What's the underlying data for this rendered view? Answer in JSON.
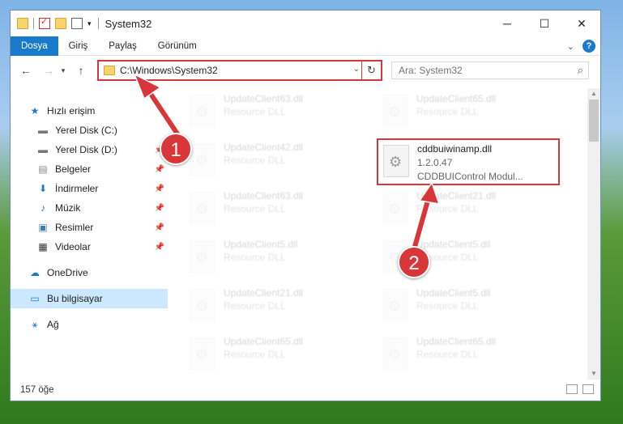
{
  "window": {
    "title": "System32",
    "minimize": "─",
    "maximize": "☐",
    "close": "✕"
  },
  "ribbon": {
    "tabs": [
      "Dosya",
      "Giriş",
      "Paylaş",
      "Görünüm"
    ],
    "expand_icon": "chevron-down-icon",
    "help": "?"
  },
  "address": {
    "path": "C:\\Windows\\System32",
    "search_placeholder": "Ara: System32"
  },
  "sidebar": {
    "items": [
      {
        "label": "Hızlı erişim",
        "icon": "star-icon"
      },
      {
        "label": "Yerel Disk (C:)",
        "icon": "drive-icon"
      },
      {
        "label": "Yerel Disk (D:)",
        "icon": "drive-icon"
      },
      {
        "label": "Belgeler",
        "icon": "documents-icon"
      },
      {
        "label": "İndirmeler",
        "icon": "download-icon"
      },
      {
        "label": "Müzik",
        "icon": "music-icon"
      },
      {
        "label": "Resimler",
        "icon": "pictures-icon"
      },
      {
        "label": "Videolar",
        "icon": "video-icon"
      },
      {
        "label": "OneDrive",
        "icon": "cloud-icon"
      },
      {
        "label": "Bu bilgisayar",
        "icon": "computer-icon"
      },
      {
        "label": "Ağ",
        "icon": "network-icon"
      }
    ]
  },
  "files": {
    "left": [
      {
        "name": "UpdateClient63.dll",
        "desc": "Resource DLL"
      },
      {
        "name": "UpdateClient42.dll",
        "desc": "Resource DLL"
      },
      {
        "name": "UpdateClient63.dll",
        "desc": "Resource DLL"
      },
      {
        "name": "UpdateClient5.dll",
        "desc": "Resource DLL"
      },
      {
        "name": "UpdateClient21.dll",
        "desc": "Resource DLL"
      },
      {
        "name": "UpdateClient65.dll",
        "desc": "Resource DLL"
      }
    ],
    "right": [
      {
        "name": "UpdateClient65.dll",
        "desc": "Resource DLL"
      },
      {
        "name": "UpdateClient21.dll",
        "desc": "Resource DLL"
      },
      {
        "name": "UpdateClient5.dll",
        "desc": "Resource DLL"
      },
      {
        "name": "UpdateClient5.dll",
        "desc": "Resource DLL"
      },
      {
        "name": "UpdateClient65.dll",
        "desc": "Resource DLL"
      }
    ],
    "highlighted": {
      "name": "cddbuiwinamp.dll",
      "version": "1.2.0.47",
      "desc": "CDDBUIControl Modul..."
    }
  },
  "status": {
    "count": "157 öğe"
  },
  "callouts": [
    "1",
    "2"
  ],
  "colors": {
    "accent": "#1979ca",
    "highlight": "#d9363a",
    "selected": "#cce8ff"
  }
}
